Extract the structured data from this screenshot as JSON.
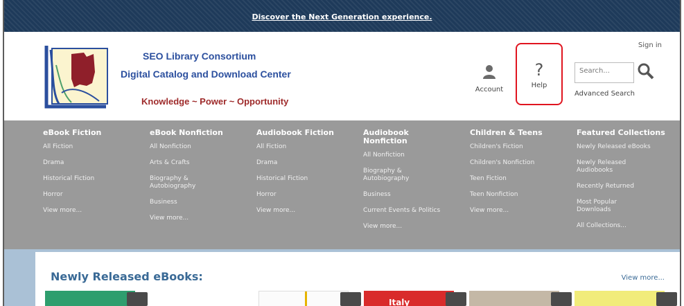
{
  "banner": {
    "link_text": "Discover the Next Generation experience."
  },
  "header": {
    "org_title": "SEO Library Consortium",
    "org_subtitle": "Digital Catalog and Download Center",
    "tagline": "Knowledge ~ Power ~ Opportunity",
    "sign_in": "Sign in",
    "account_label": "Account",
    "help_label": "Help",
    "help_glyph": "?",
    "search_placeholder": "Search...",
    "advanced_search": "Advanced Search"
  },
  "nav": {
    "columns": [
      {
        "title": "eBook Fiction",
        "items": [
          "All Fiction",
          "Drama",
          "Historical Fiction",
          "Horror",
          "View more..."
        ]
      },
      {
        "title": "eBook Nonfiction",
        "items": [
          "All Nonfiction",
          "Arts & Crafts",
          "Biography & Autobiography",
          "Business",
          "View more..."
        ]
      },
      {
        "title": "Audiobook Fiction",
        "items": [
          "All Fiction",
          "Drama",
          "Historical Fiction",
          "Horror",
          "View more..."
        ]
      },
      {
        "title": "Audiobook Nonfiction",
        "items": [
          "All Nonfiction",
          "Biography & Autobiography",
          "Business",
          "Current Events & Politics",
          "View more..."
        ]
      },
      {
        "title": "Children & Teens",
        "items": [
          "Children's Fiction",
          "Children's Nonfiction",
          "Teen Fiction",
          "Teen Nonfiction",
          "View more..."
        ]
      },
      {
        "title": "Featured Collections",
        "items": [
          "Newly Released eBooks",
          "Newly Released Audiobooks",
          "Recently Returned",
          "Most Popular Downloads",
          "All Collections..."
        ]
      }
    ]
  },
  "content": {
    "section_title": "Newly Released eBooks:",
    "view_more": "View more...",
    "book_cover_text": [
      "Italy"
    ]
  },
  "colors": {
    "banner_bg": "#1e3a5a",
    "nav_bg": "#9a9a9a",
    "help_highlight": "#e0141f",
    "title_blue": "#2b4f9e",
    "tagline_red": "#9e2a2a"
  }
}
